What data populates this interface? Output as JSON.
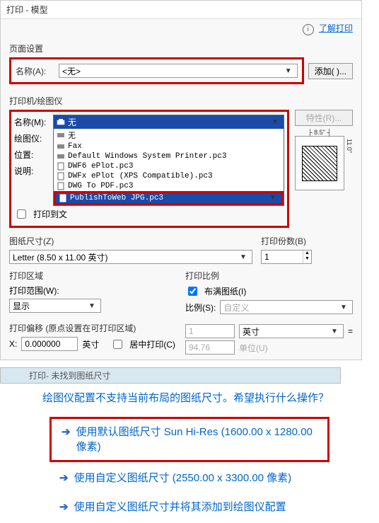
{
  "titlebar": "打印 - 模型",
  "helpLink": "了解打印",
  "pageSetup": {
    "title": "页面设置",
    "nameLabel": "名称(A):",
    "nameValue": "<无>",
    "addBtn": "添加( )..."
  },
  "printer": {
    "title": "打印机/绘图仪",
    "nameLabel": "名称(M):",
    "plotterLabel": "绘图仪:",
    "locLabel": "位置:",
    "descLabel": "说明:",
    "propsBtn": "特性(R)...",
    "selected": "无",
    "items": [
      "无",
      "Fax",
      "Default Windows System Printer.pc3",
      "DWF6 ePlot.pc3",
      "DWFx ePlot (XPS Compatible).pc3",
      "DWG To PDF.pc3",
      "PublishToWeb JPG.pc3"
    ],
    "printToFile": "打印到文",
    "widthDim": "8.5\"",
    "heightDim": "11.0\""
  },
  "paper": {
    "title": "图纸尺寸(Z)",
    "value": "Letter (8.50 x 11.00 英寸)"
  },
  "copies": {
    "title": "打印份数(B)",
    "value": "1"
  },
  "printArea": {
    "title": "打印区域",
    "rangeLabel": "打印范围(W):",
    "rangeValue": "显示"
  },
  "scale": {
    "title": "打印比例",
    "fitLabel": "布满图纸(I)",
    "ratioLabel": "比例(S):",
    "ratioValue": "自定义",
    "unit1": "1",
    "unit1Label": "英寸",
    "unit2": "94.76",
    "unit2Label": "单位(U)"
  },
  "offset": {
    "title": "打印偏移 (原点设置在可打印区域)",
    "xLabel": "X:",
    "xValue": "0.000000",
    "xUnit": "英寸",
    "centerLabel": "居中打印(C)"
  },
  "errorTitle": "打印- 未找到图纸尺寸",
  "question": "绘图仪配置不支持当前布局的图纸尺寸。希望执行什么操作？",
  "opt1": "使用默认图纸尺寸 Sun Hi-Res (1600.00 x 1280.00 像素)",
  "opt2": "使用自定义图纸尺寸 (2550.00 x 3300.00 像素)",
  "opt3": "使用自定义图纸尺寸并将其添加到绘图仪配置"
}
